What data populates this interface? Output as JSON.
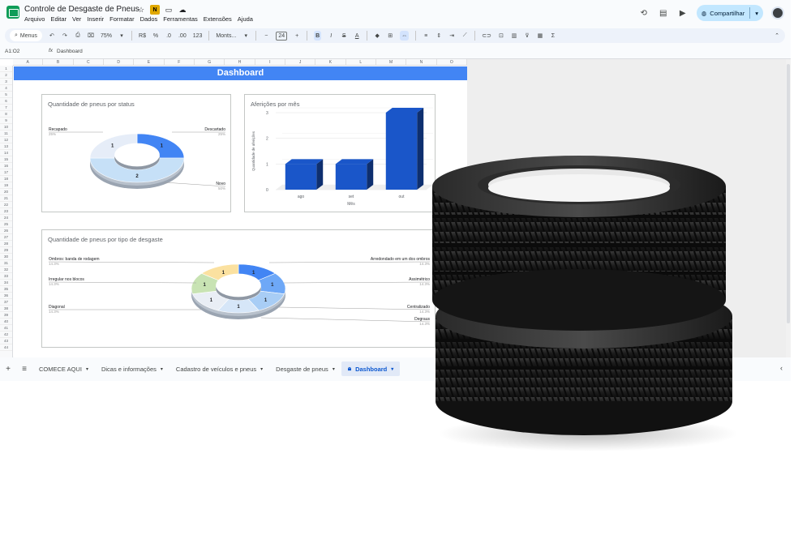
{
  "app": {
    "doc_title": "Controle de Desgaste de Pneus",
    "menu": [
      "Arquivo",
      "Editar",
      "Ver",
      "Inserir",
      "Formatar",
      "Dados",
      "Ferramentas",
      "Extensões",
      "Ajuda"
    ],
    "share_label": "Compartilhar"
  },
  "toolbar": {
    "menus_label": "Menus",
    "zoom": "75%",
    "currency": "R$",
    "percent": "%",
    "dec_minus": ".0",
    "dec_plus": ".00",
    "number_format": "123",
    "font": "Monts...",
    "font_size": "24"
  },
  "formula": {
    "cell_ref": "A1:O2",
    "value": "Dashboard"
  },
  "grid": {
    "columns": [
      "A",
      "B",
      "C",
      "D",
      "E",
      "F",
      "G",
      "H",
      "I",
      "J",
      "K",
      "L",
      "M",
      "N",
      "O"
    ],
    "rows": [
      "1",
      "2",
      "3",
      "4",
      "5",
      "6",
      "7",
      "8",
      "9",
      "10",
      "11",
      "12",
      "13",
      "14",
      "15",
      "16",
      "17",
      "18",
      "19",
      "20",
      "21",
      "22",
      "23",
      "24",
      "25",
      "26",
      "27",
      "28",
      "29",
      "30",
      "31",
      "32",
      "33",
      "34",
      "35",
      "36",
      "37",
      "38",
      "39",
      "40",
      "41",
      "42",
      "43",
      "44"
    ]
  },
  "dashboard": {
    "banner": "Dashboard",
    "chart_data": [
      {
        "type": "pie",
        "title": "Quantidade de pneus por status",
        "variant": "donut-3d",
        "slices": [
          {
            "name": "Descartado",
            "value": 1,
            "percent": "25%",
            "color": "#4285f4"
          },
          {
            "name": "Novo",
            "value": 2,
            "percent": "50%",
            "color": "#c6e0f7"
          },
          {
            "name": "Recapado",
            "value": 1,
            "percent": "25%",
            "color": "#e6edf8"
          }
        ]
      },
      {
        "type": "bar",
        "title": "Aferições por mês",
        "variant": "3d",
        "categories": [
          "ago",
          "set",
          "out"
        ],
        "values": [
          1,
          1,
          3
        ],
        "xlabel": "Mês",
        "ylabel": "Quantidade de aferições",
        "ylim": [
          0,
          3
        ],
        "yticks": [
          "0",
          "1",
          "2",
          "3"
        ],
        "color": "#1a56c9"
      },
      {
        "type": "pie",
        "title": "Quantidade de pneus por tipo de desgaste",
        "variant": "donut-3d",
        "slices": [
          {
            "name": "Arredondado em um dos ombros",
            "value": 1,
            "percent": "14.3%",
            "color": "#4285f4"
          },
          {
            "name": "Assimétrico",
            "value": 1,
            "percent": "14.3%",
            "color": "#6ea8f7"
          },
          {
            "name": "Centralizado",
            "value": 1,
            "percent": "14.3%",
            "color": "#a8cdf5"
          },
          {
            "name": "Degraus",
            "value": 1,
            "percent": "14.3%",
            "color": "#d6e6f8"
          },
          {
            "name": "Diagonal",
            "value": 1,
            "percent": "14.3%",
            "color": "#e9eef5"
          },
          {
            "name": "Irregular nos blocos",
            "value": 1,
            "percent": "14.3%",
            "color": "#c8e3b3"
          },
          {
            "name": "Ombros: banda de rodagem",
            "value": 1,
            "percent": "14.3%",
            "color": "#fbe1a0"
          }
        ]
      }
    ]
  },
  "tabs": [
    {
      "label": "COMECE AQUI"
    },
    {
      "label": "Dicas e informações"
    },
    {
      "label": "Cadastro de veículos e pneus"
    },
    {
      "label": "Desgaste de pneus"
    },
    {
      "label": "Dashboard",
      "active": true
    }
  ]
}
